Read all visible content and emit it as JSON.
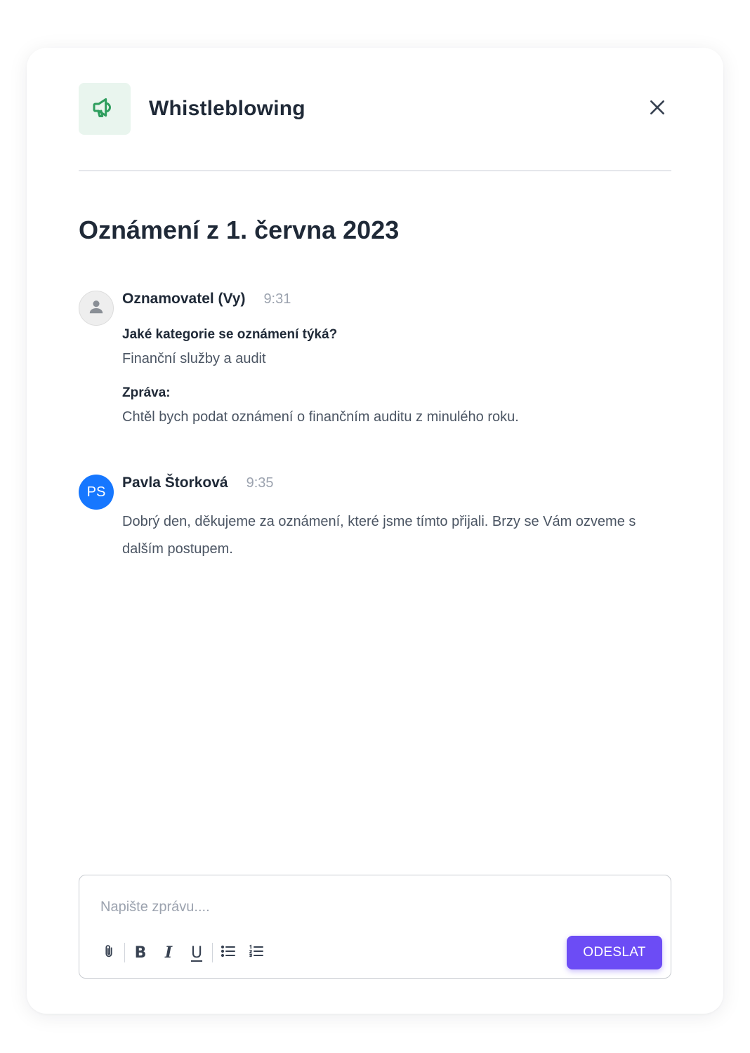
{
  "app": {
    "title": "Whistleblowing",
    "icon": "megaphone-icon",
    "icon_color": "#2f9e5e",
    "icon_bg": "#e9f5ee"
  },
  "report": {
    "title": "Oznámení z 1. června 2023"
  },
  "messages": [
    {
      "author": "Oznamovatel (Vy)",
      "time": "9:31",
      "avatar": "user-icon",
      "fields": [
        {
          "label": "Jaké kategorie se oznámení týká?",
          "value": "Finanční služby a audit"
        },
        {
          "label": "Zpráva:",
          "value": "Chtěl bych podat oznámení o finančním auditu z minulého roku."
        }
      ]
    },
    {
      "author": "Pavla Štorková",
      "time": "9:35",
      "avatar_initials": "PS",
      "avatar_color": "#1677ff",
      "text": "Dobrý den, děkujeme za oznámení, které jsme tímto přijali. Brzy se Vám ozveme s dalším postupem."
    }
  ],
  "composer": {
    "placeholder": "Napište zprávu....",
    "value": "",
    "toolbar": {
      "attach": "paperclip-icon",
      "bold": "B",
      "italic": "I",
      "underline": "U",
      "bullet_list": "bullet-list-icon",
      "numbered_list": "numbered-list-icon"
    },
    "send_label": "ODESLAT",
    "send_color": "#6c4cf5"
  }
}
